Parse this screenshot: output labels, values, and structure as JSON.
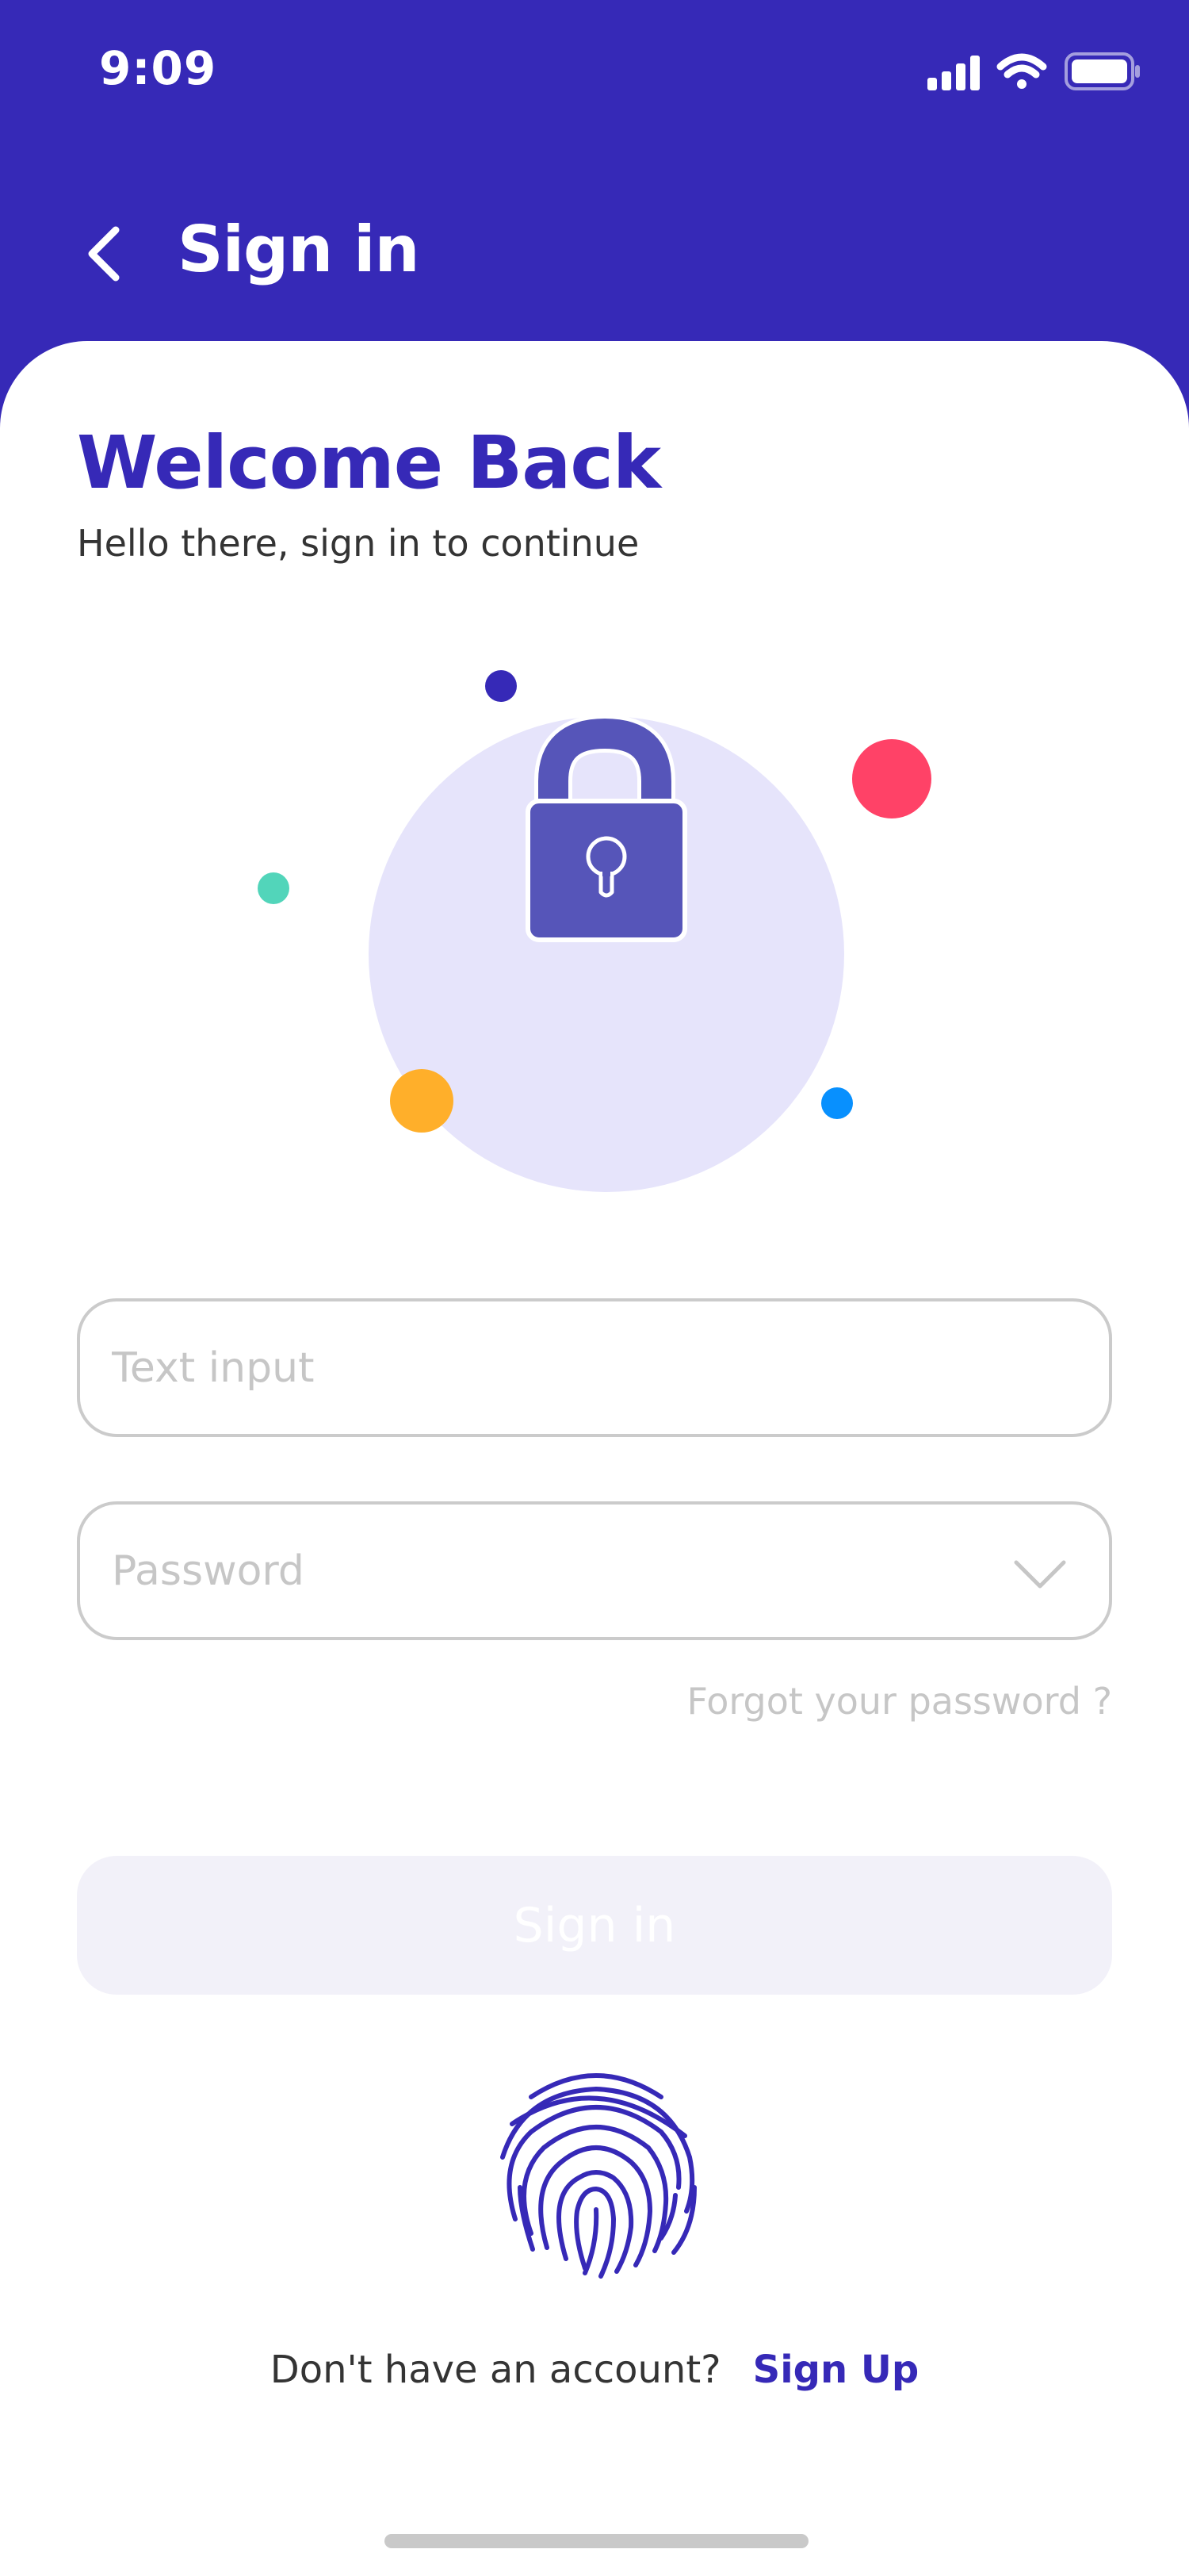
{
  "status_bar": {
    "time": "9:09",
    "icons": [
      "signal-icon",
      "wifi-icon",
      "battery-icon"
    ]
  },
  "header": {
    "title": "Sign in",
    "back_icon": "chevron-left-icon"
  },
  "welcome": {
    "title": "Welcome Back",
    "subtitle": "Hello there, sign in to continue"
  },
  "illustration": {
    "icon": "lock-icon",
    "colors": {
      "circle": "#E6E4FB",
      "lock": "#5655B9",
      "dot_navy": "#3629B7",
      "dot_red": "#FF4267",
      "dot_teal": "#52D5BA",
      "dot_orange": "#FFAF2A",
      "dot_blue": "#0890FE"
    }
  },
  "form": {
    "email_placeholder": "Text input",
    "password_placeholder": "Password",
    "password_icon": "chevron-down-icon",
    "forgot": "Forgot your password ?",
    "submit": "Sign in"
  },
  "biometric": {
    "icon": "fingerprint-icon"
  },
  "signup": {
    "question": "Don't have an account?",
    "link": "Sign Up"
  },
  "theme": {
    "primary": "#3629B7",
    "button_disabled": "#F2F1F9",
    "border": "#CBCBCB",
    "placeholder": "#C6C6C6",
    "text": "#343434"
  }
}
